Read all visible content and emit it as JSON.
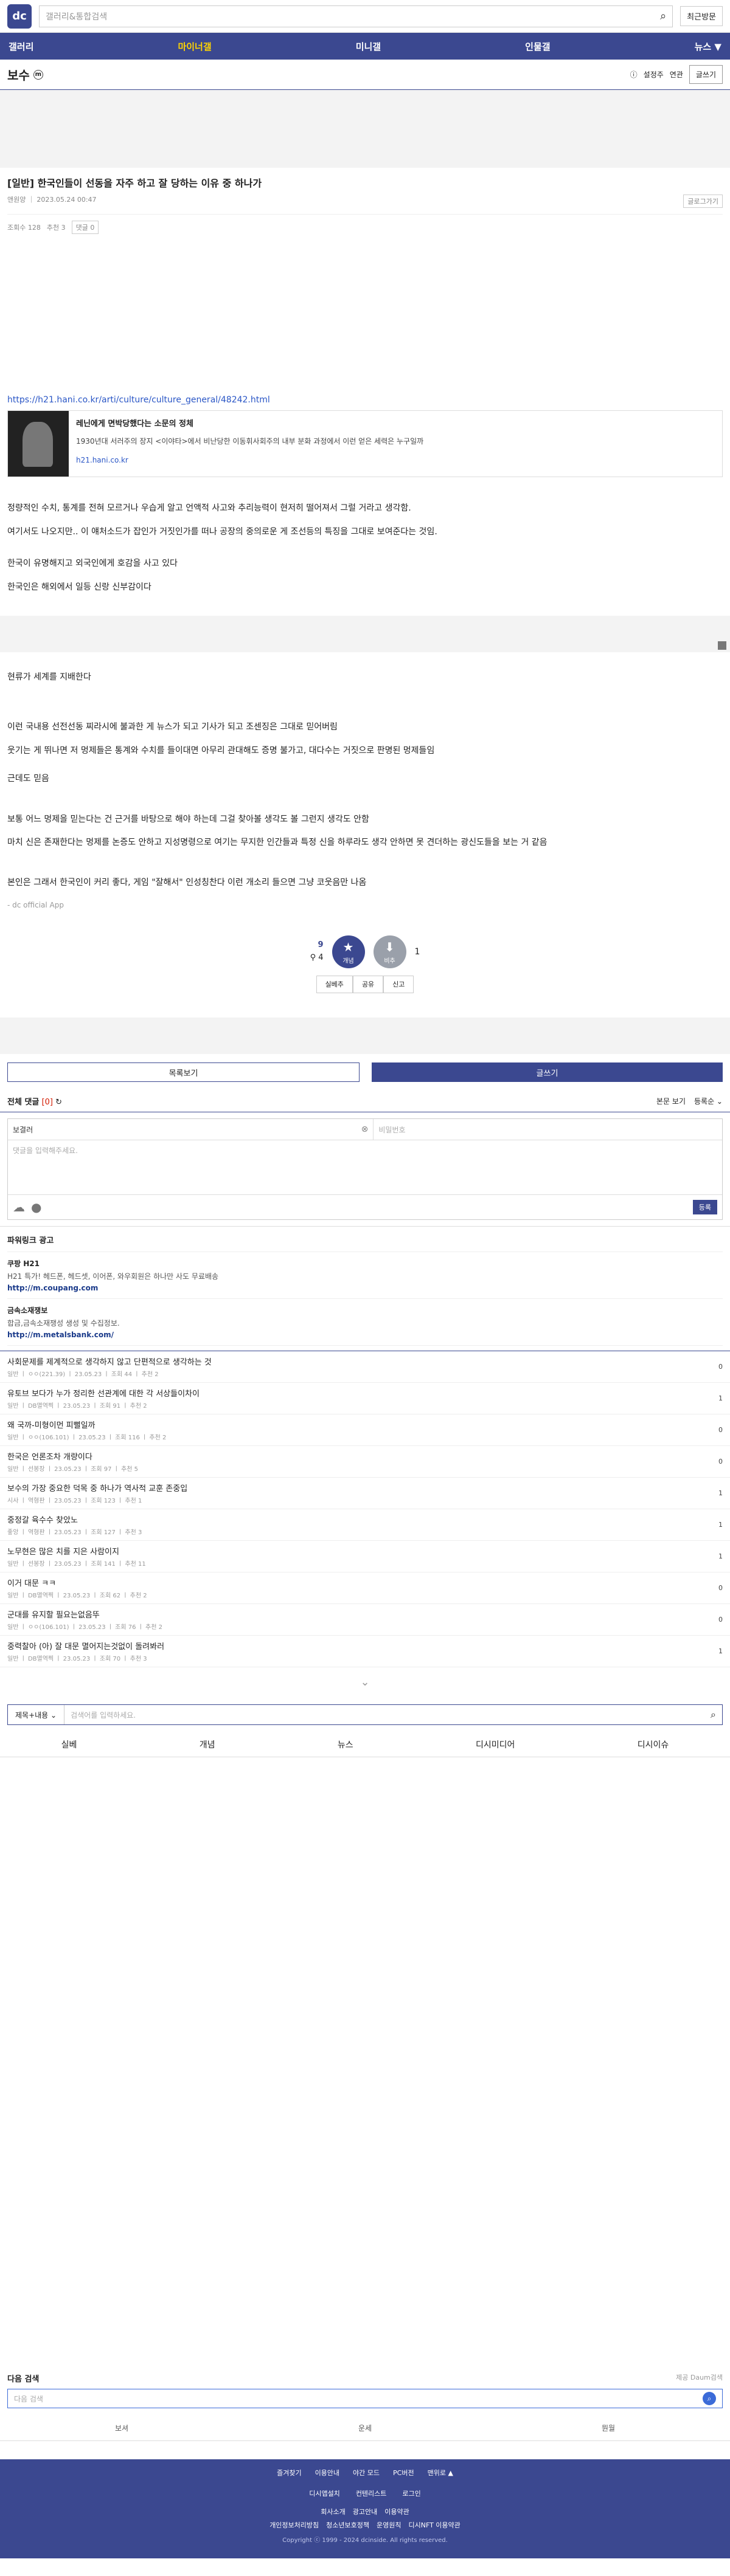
{
  "header": {
    "logo": "dc",
    "search_placeholder": "갤러리&통합검색",
    "recent_label": "최근방문"
  },
  "nav": {
    "items": [
      "갤러리",
      "마이너갤",
      "미니갤",
      "인물갤",
      "뉴스 ▼"
    ]
  },
  "gallery": {
    "title": "보수",
    "badge": "m",
    "info": "설정주",
    "info2": "연관",
    "write": "글쓰기"
  },
  "post": {
    "title": "[일반] 한국인들이 선동을 자주 하고 잘 당하는 이유 중 하나가",
    "author": "앤원양",
    "date": "2023.05.24 00:47",
    "more": "글로그가기",
    "views": "조회수 128",
    "recommends": "추천 3",
    "comments_tag": "댓글 0",
    "link_url": "https://h21.hani.co.kr/arti/culture/culture_general/48242.html",
    "card": {
      "title": "레닌에게 면박당했다는 소문의 정체",
      "desc": "1930년대 서러주의 장지 <이야타>에서 비난당한 이동휘사회주의 내부 분화 과정에서 이런 얻은 세력은 누구일까",
      "site": "h21.hani.co.kr"
    },
    "paragraphs": [
      "정량적인 수치, 통계를 전혀 모르거나 우습게 알고 언액적 사고와 추리능력이 현저히 떨어져서 그럴 거라고 생각함.",
      "여기서도 나오지만.. 이 얘처소드가 잡인가 거짓인가를 떠나 공장의 중의로운 게 조선등의 특징을 그대로 보여준다는 것임.",
      "한국이 유명해지고 외국인에게 호감을 사고 있다",
      "한국인은 해외에서 일등 신랑 신부감이다",
      "현류가 세계를 지배한다",
      "이런 국내용 선전선동 찌라시에 불과한 게 뉴스가 되고 기사가 되고 조센징은 그대로 믿어버림",
      "웃기는 게 뛰나면 저 멍제들은 통계와 수치를 들이대면 아무리 관대해도 증명 불가고, 대다수는 거짓으로 판명된 멍제들임",
      "근데도 믿음",
      "보통 어느 멍제을 믿는다는 건 근거를 바탕으로 해야 하는데 그걸 찾아볼 생각도 볼 그런지 생각도 안함",
      "마치 신은 존재한다는 멍제를 논증도 안하고 지성명령으로 여기는 무지한 인간들과 특정 신을 하루라도 생각 안하면 못 견더하는 광신도들을 보는 거 같음",
      "본인은 그래서 한국인이 커리 좋다, 게임 \"잘해서\" 인성칭찬다 이런 개소리 들으면 그냥 코웃음만 나옴"
    ],
    "app_source": "- dc official App",
    "up_count": "9",
    "fix_count": "4",
    "up_label": "개념",
    "down_count": "1",
    "down_label": "비추",
    "share": [
      "실베추",
      "공유",
      "신고"
    ]
  },
  "actions": {
    "list": "목록보기",
    "write": "글쓰기"
  },
  "comments": {
    "title": "전체 댓글",
    "count": "[0]",
    "sort1": "본문 보기",
    "sort2": "등록순 ⌄",
    "name_value": "보결러",
    "pw_placeholder": "비밀번호",
    "text_placeholder": "댓글을 입력해주세요.",
    "submit": "등록"
  },
  "powerlink": {
    "title": "파워링크 광고",
    "items": [
      {
        "name": "쿠팡 H21",
        "desc": "H21 특가! 헤드폰, 헤드셋, 이어폰, 와우회원은 하나만 사도 무료배송",
        "url": "http://m.coupang.com"
      },
      {
        "name": "금속소재쟁보",
        "desc": "합금,금속소재쟁성 생성 및 수집정보.",
        "url": "http://m.metalsbank.com/"
      }
    ]
  },
  "list": [
    {
      "title": "사회문제를 제계적으로 생각하지 않고 단편적으로 생각하는 것",
      "meta": "일반 ㅣ ㅇㅇ(221.39) ㅣ 23.05.23 ㅣ 조회 44 ㅣ 추천 2",
      "count": "0"
    },
    {
      "title": "유토브 보다가 누가 정리한 선관계에 대한 각 서상들이차이",
      "meta": "일반 ㅣ DB멸역찍 ㅣ 23.05.23 ㅣ 조회 91 ㅣ 추천 2",
      "count": "1"
    },
    {
      "title": "왜 국까-미형이먼 피뻘일까",
      "meta": "일반 ㅣ ㅇㅇ(106.101) ㅣ 23.05.23 ㅣ 조회 116 ㅣ 추천 2",
      "count": "0"
    },
    {
      "title": "한국은 언론조차 개량이다",
      "meta": "일반 ㅣ 선봉장 ㅣ 23.05.23 ㅣ 조회 97 ㅣ 추천 5",
      "count": "0"
    },
    {
      "title": "보수의 가장 중요한 덕목 중 하나가 역사적 교훈 존중입",
      "meta": "시사 ㅣ 역형판 ㅣ 23.05.23 ㅣ 조회 123 ㅣ 추천 1",
      "count": "1"
    },
    {
      "title": "중정갈 육수수 찾았노",
      "meta": "좋앙 ㅣ 역형판 ㅣ 23.05.23 ㅣ 조회 127 ㅣ 추천 3",
      "count": "1"
    },
    {
      "title": "노무현은 많은 치를 지은 사람이지",
      "meta": "일반 ㅣ 선봉장 ㅣ 23.05.23 ㅣ 조회 141 ㅣ 추천 11",
      "count": "1"
    },
    {
      "title": "이거 대문 ㅋㅋ",
      "meta": "일반 ㅣ DB멸역찍 ㅣ 23.05.23 ㅣ 조회 62 ㅣ 추천 2",
      "count": "0"
    },
    {
      "title": "군대를 유지할 필요는없음뚜",
      "meta": "일반 ㅣ ㅇㅇ(106.101) ㅣ 23.05.23 ㅣ 조회 76 ㅣ 추천 2",
      "count": "0"
    },
    {
      "title": "중력찰아 (아) 잘 대문 멸어지는것없이 돌려봐러",
      "meta": "일반 ㅣ DB멸역찍 ㅣ 23.05.23 ㅣ 조회 70 ㅣ 추천 3",
      "count": "1"
    }
  ],
  "bottom_search": {
    "select": "제목+내용 ⌄",
    "placeholder": "검색어를 입력하세요."
  },
  "categories": [
    "실베",
    "개념",
    "뉴스",
    "디시미디어",
    "디시이슈"
  ],
  "daum": {
    "title": "다음 검색",
    "sub": "제공 Daum검색",
    "placeholder": "다음 검색",
    "links": [
      "보셔",
      "운세",
      "뭔월"
    ]
  },
  "footer": {
    "r1": [
      "즐겨찾기",
      "이용안내",
      "야간 모드",
      "PC버전",
      "맨위로 ▲"
    ],
    "r2": [
      "디시앱설치",
      "컨텐리스트",
      "로그인"
    ],
    "r3": [
      "회사소개",
      "광고안내",
      "이용약관"
    ],
    "r4": [
      "개인정보처리방침",
      "청소년보호정책",
      "운영원칙",
      "디시NFT 이용약관"
    ],
    "copy": "Copyright ⓒ 1999 - 2024 dcinside. All rights reserved."
  }
}
